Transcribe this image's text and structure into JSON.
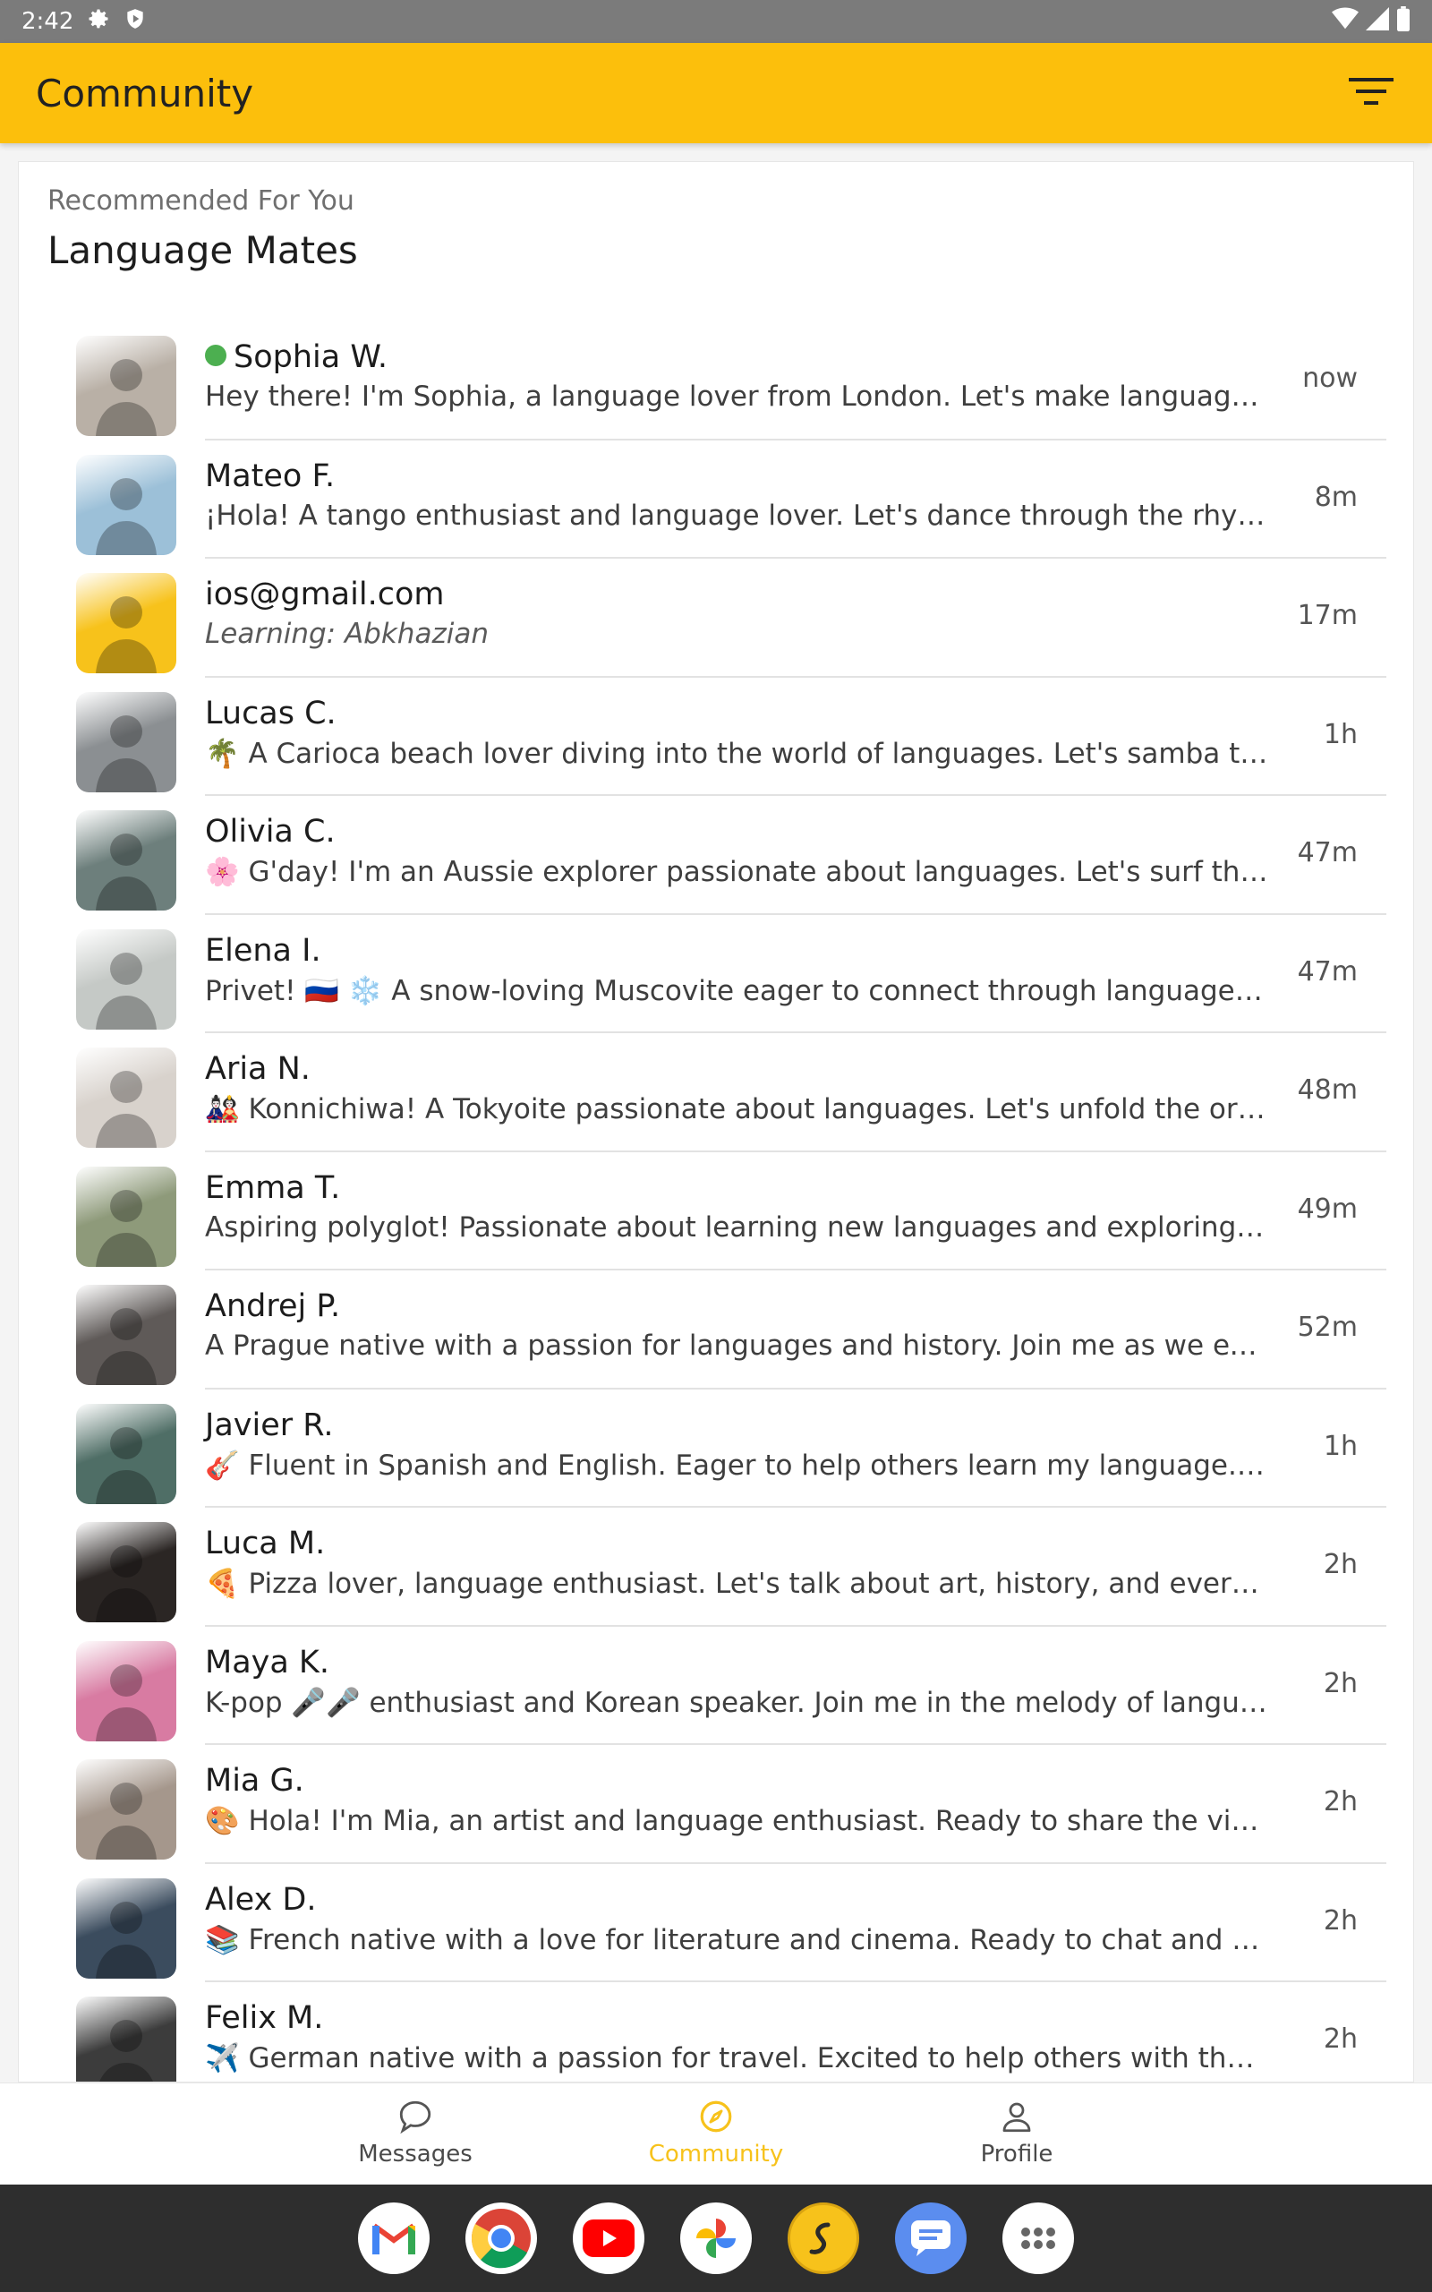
{
  "status_bar": {
    "time": "2:42",
    "icons": [
      "gear-icon",
      "shield-icon",
      "wifi-icon",
      "signal-icon",
      "battery-icon"
    ]
  },
  "app_bar": {
    "title": "Community",
    "filter_icon": "filter-icon",
    "color": "#fcbf0c"
  },
  "section": {
    "subtitle": "Recommended For You",
    "title": "Language Mates"
  },
  "users": [
    {
      "name": "Sophia W.",
      "online": true,
      "bio": "Hey there! I'm Sophia, a language lover from London. Let's make language lear...",
      "time": "now",
      "learning": false,
      "avatar_color": "#b9b0a6"
    },
    {
      "name": "Mateo F.",
      "online": false,
      "bio": "¡Hola! A tango enthusiast and language lover. Let's dance through the rhythms ...",
      "time": "8m",
      "learning": false,
      "avatar_color": "#9cc0d8"
    },
    {
      "name": "ios@gmail.com",
      "online": false,
      "bio": "Learning: Abkhazian",
      "time": "17m",
      "learning": true,
      "avatar_color": "#f7c21b"
    },
    {
      "name": "Lucas C.",
      "online": false,
      "bio": "🌴 A Carioca beach lover diving into the world of languages. Let's samba throug...",
      "time": "1h",
      "learning": false,
      "avatar_color": "#8b8f92"
    },
    {
      "name": "Olivia C.",
      "online": false,
      "bio": "🌸 G'day! I'm an Aussie explorer passionate about languages. Let's surf the wav...",
      "time": "47m",
      "learning": false,
      "avatar_color": "#6d7f7c"
    },
    {
      "name": "Elena I.",
      "online": false,
      "bio": "Privet! 🇷🇺 ❄️ A snow-loving Muscovite eager to connect through languages. Let...",
      "time": "47m",
      "learning": false,
      "avatar_color": "#c5c9c6"
    },
    {
      "name": "Aria N.",
      "online": false,
      "bio": "🎎 Konnichiwa! A Tokyoite passionate about languages. Let's unfold the origa...",
      "time": "48m",
      "learning": false,
      "avatar_color": "#d8d2cc"
    },
    {
      "name": "Emma T.",
      "online": false,
      "bio": "Aspiring polyglot! Passionate about learning new languages and exploring diff...",
      "time": "49m",
      "learning": false,
      "avatar_color": "#8e9a7a"
    },
    {
      "name": "Andrej P.",
      "online": false,
      "bio": "A Prague native with a passion for languages and history. Join me as we explo...",
      "time": "52m",
      "learning": false,
      "avatar_color": "#5f5a58"
    },
    {
      "name": "Javier R.",
      "online": false,
      "bio": "🎸 Fluent in Spanish and English. Eager to help others learn my language. Strum...",
      "time": "1h",
      "learning": false,
      "avatar_color": "#4f6e66"
    },
    {
      "name": "Luca M.",
      "online": false,
      "bio": "🍕 Pizza lover, language enthusiast. Let's talk about art, history, and everything It...",
      "time": "2h",
      "learning": false,
      "avatar_color": "#2b2624"
    },
    {
      "name": "Maya K.",
      "online": false,
      "bio": "K-pop 🎤🎤 enthusiast and Korean speaker. Join me in the melody of languages ...",
      "time": "2h",
      "learning": false,
      "avatar_color": "#d87ba2"
    },
    {
      "name": "Mia G.",
      "online": false,
      "bio": "🎨 Hola! I'm Mia, an artist and language enthusiast. Ready to share the vibrancy ...",
      "time": "2h",
      "learning": false,
      "avatar_color": "#a5978c"
    },
    {
      "name": "Alex D.",
      "online": false,
      "bio": "📚 French native with a love for literature and cinema. Ready to chat and exchan...",
      "time": "2h",
      "learning": false,
      "avatar_color": "#3b4c5e"
    },
    {
      "name": "Felix M.",
      "online": false,
      "bio": "✈️ German native with a passion for travel. Excited to help others with the Germ...",
      "time": "2h",
      "learning": false,
      "avatar_color": "#3c3c3c"
    }
  ],
  "bottom_nav": [
    {
      "label": "Messages",
      "icon": "chat-bubble-icon",
      "active": false
    },
    {
      "label": "Community",
      "icon": "compass-icon",
      "active": true
    },
    {
      "label": "Profile",
      "icon": "person-icon",
      "active": false
    }
  ],
  "dock": [
    {
      "app": "Gmail",
      "icon": "gmail-icon",
      "color": "#ffffff"
    },
    {
      "app": "Chrome",
      "icon": "chrome-icon",
      "color": "#ffffff"
    },
    {
      "app": "YouTube",
      "icon": "youtube-icon",
      "color": "#ffffff"
    },
    {
      "app": "Photos",
      "icon": "photos-icon",
      "color": "#ffffff"
    },
    {
      "app": "Language app",
      "icon": "language-app-icon",
      "color": "#f7c21b"
    },
    {
      "app": "Messages",
      "icon": "sms-icon",
      "color": "#5b8def"
    },
    {
      "app": "Apps",
      "icon": "app-drawer-icon",
      "color": "#ffffff"
    }
  ]
}
